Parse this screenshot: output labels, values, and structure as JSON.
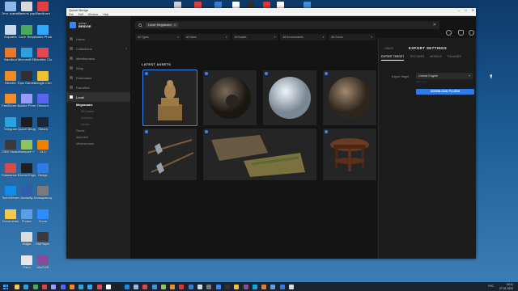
{
  "desktop": {
    "icons": [
      {
        "label": "Этот компьютер",
        "color": "#8fb8e8"
      },
      {
        "label": "Панель управления",
        "color": "#d9d9d9"
      },
      {
        "label": "Bandicam",
        "color": "#e04040"
      },
      {
        "label": "Корзина",
        "color": "#c8d8e8"
      },
      {
        "label": "Core Temp",
        "color": "#4aa85a"
      },
      {
        "label": "Adobe Photoshop",
        "color": "#31a8ff"
      },
      {
        "label": "Bandicut",
        "color": "#e87a2a"
      },
      {
        "label": "Microsoft Edge",
        "color": "#2e9fd8"
      },
      {
        "label": "Creative Cloud",
        "color": "#e34850"
      },
      {
        "label": "Blender",
        "color": "#f08a24"
      },
      {
        "label": "Epic Games",
        "color": "#303030"
      },
      {
        "label": "Google Chrome",
        "color": "#f2c12e"
      },
      {
        "label": "FastStone Capture",
        "color": "#f28c28"
      },
      {
        "label": "Adobe Premiere Pro",
        "color": "#9999ff"
      },
      {
        "label": "Discord",
        "color": "#5865f2"
      },
      {
        "label": "Telegram",
        "color": "#2aa3e0"
      },
      {
        "label": "Quixel Bridge",
        "color": "#1e1e1e"
      },
      {
        "label": "Steam",
        "color": "#1b2838"
      },
      {
        "label": "OBS Studio",
        "color": "#3a3a3a"
      },
      {
        "label": "Notepad++",
        "color": "#90c45a"
      },
      {
        "label": "VLC",
        "color": "#f08000"
      },
      {
        "label": "Substance Painter",
        "color": "#d54a4a"
      },
      {
        "label": "Unreal Engine",
        "color": "#202020"
      },
      {
        "label": "Bridge",
        "color": "#2f7be6"
      },
      {
        "label": "TeamViewer",
        "color": "#0e8ee9"
      },
      {
        "label": "Audacity",
        "color": "#2f5da8"
      },
      {
        "label": "Калькулятор",
        "color": "#7a7a7a"
      },
      {
        "label": "Documents",
        "color": "#f2c94c"
      },
      {
        "label": "Photos",
        "color": "#5aa0e0"
      },
      {
        "label": "Zoom",
        "color": "#2d8cff"
      },
      {
        "label": "Skype",
        "color": "#00aff0"
      },
      {
        "label": "KMPlayer",
        "color": "#3a3a3a"
      },
      {
        "label": "7-Zip",
        "color": "#dcdcdc"
      },
      {
        "label": "WinRAR",
        "color": "#8a4a9a"
      },
      {
        "label": "Paint",
        "color": "#e8e8e8"
      }
    ],
    "top_icons": [
      {
        "label": "",
        "color": "#d0d0d0"
      },
      {
        "label": "",
        "color": "#e04040"
      },
      {
        "label": "",
        "color": "#3a7bd5"
      },
      {
        "label": "",
        "color": "#ffffff"
      },
      {
        "label": "",
        "color": "#303030"
      },
      {
        "label": "",
        "color": "#e83030"
      },
      {
        "label": "",
        "color": "#ffffff"
      },
      {
        "label": "",
        "color": "#4090e0"
      }
    ]
  },
  "window": {
    "title": "Quixel Bridge",
    "menu": [
      "File",
      "Edit",
      "Window",
      "Help"
    ],
    "controls": [
      "–",
      "□",
      "✕"
    ]
  },
  "sidebar": {
    "logo_line1": "QUIXEL",
    "logo_line2": "BRIDGE",
    "items": [
      {
        "label": "Home",
        "count": ""
      },
      {
        "label": "Collections",
        "count": "5"
      },
      {
        "label": "Metahumans",
        "count": ""
      },
      {
        "label": "Shop",
        "count": ""
      },
      {
        "label": "Purchased",
        "count": ""
      },
      {
        "label": "Favorites",
        "count": ""
      },
      {
        "label": "Local",
        "count": ""
      }
    ],
    "local_children": [
      {
        "label": "Megascans",
        "count": "",
        "selected": true
      },
      {
        "label": "3D Assets",
        "count": "",
        "level": 2
      },
      {
        "label": "Surfaces",
        "count": "",
        "level": 2
      },
      {
        "label": "Decals",
        "count": "",
        "level": 2
      },
      {
        "label": "Plants",
        "count": "",
        "level": 1
      },
      {
        "label": "Imported",
        "count": "",
        "level": 1
      },
      {
        "label": "Metahumans",
        "count": "",
        "level": 1
      }
    ]
  },
  "search": {
    "chip": "Local: Megascans",
    "chip_close": "×"
  },
  "filters": [
    "All Types",
    "All Sizes",
    "All Scales",
    "All Environments",
    "All Colors"
  ],
  "main": {
    "section_title": "LATEST ASSETS"
  },
  "assets": [
    {
      "name": "Statue",
      "kind": "statue",
      "selected": true
    },
    {
      "name": "Rock Surface",
      "kind": "sphere-dark",
      "selected": false
    },
    {
      "name": "Snow Surface",
      "kind": "sphere-white",
      "selected": false
    },
    {
      "name": "Sand Surface",
      "kind": "sphere-brown",
      "selected": false
    },
    {
      "name": "Axes",
      "kind": "axes",
      "selected": false
    },
    {
      "name": "Stone Wall",
      "kind": "wall",
      "selected": false
    },
    {
      "name": "Round Table",
      "kind": "table",
      "selected": false
    }
  ],
  "panel": {
    "back": "‹ BACK",
    "title": "EXPORT SETTINGS",
    "tabs": [
      "EXPORT TARGET",
      "TEXTURES",
      "MODELS",
      "FOLIAGES"
    ],
    "export_target_label": "Export Target",
    "export_target_value": "Unreal Engine",
    "note": "Learn more",
    "download_button": "DOWNLOAD PLUGIN"
  },
  "taskbar": {
    "time": "16:11",
    "date": "27.01.2022",
    "lang": "РУС",
    "icons": [
      "#f2c94c",
      "#2e9fd8",
      "#4aa85a",
      "#e04040",
      "#9999ff",
      "#5865f2",
      "#f08a24",
      "#2aa3e0",
      "#31a8ff",
      "#e34850",
      "#ffffff",
      "#1e1e1e",
      "#0e8ee9",
      "#8fb8e8",
      "#d54a4a",
      "#4090e0",
      "#90c45a",
      "#f28c28",
      "#e83030",
      "#3a7bd5",
      "#c8d8e8",
      "#7a7a7a",
      "#2d8cff",
      "#303030",
      "#f2c12e",
      "#8a4a9a",
      "#00aff0",
      "#e87a2a",
      "#5aa0e0",
      "#2f7be6",
      "#dcdcdc"
    ]
  }
}
